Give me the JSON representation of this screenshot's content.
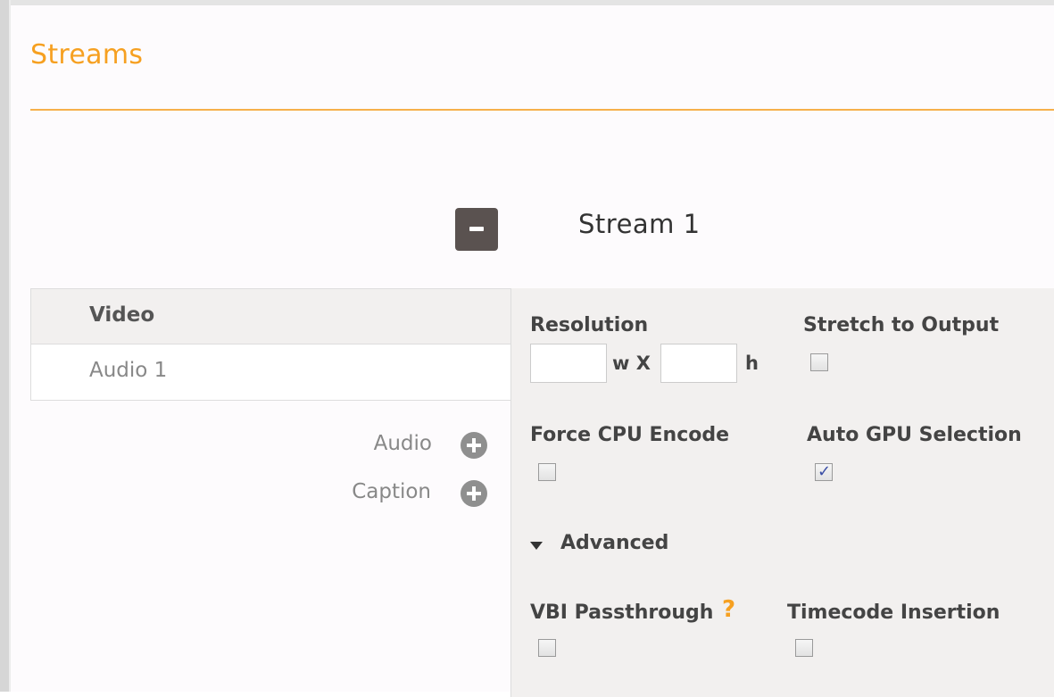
{
  "page": {
    "title": "Streams"
  },
  "stream": {
    "title": "Stream 1"
  },
  "tracks": [
    {
      "label": "Video",
      "active": true
    },
    {
      "label": "Audio 1",
      "active": false
    }
  ],
  "add_buttons": {
    "audio_label": "Audio",
    "caption_label": "Caption"
  },
  "settings": {
    "resolution_label": "Resolution",
    "width_value": "",
    "height_value": "",
    "width_suffix": "w X",
    "height_suffix": "h",
    "stretch_label": "Stretch to Output",
    "stretch_checked": false,
    "force_cpu_label": "Force CPU Encode",
    "force_cpu_checked": false,
    "auto_gpu_label": "Auto GPU Selection",
    "auto_gpu_checked": true,
    "advanced_label": "Advanced",
    "vbi_label": "VBI Passthrough",
    "vbi_help": "?",
    "vbi_checked": false,
    "timecode_label": "Timecode Insertion",
    "timecode_checked": false
  },
  "colors": {
    "accent": "#f6a021",
    "check": "#3b4fa6",
    "panel": "#f2f0ef"
  }
}
